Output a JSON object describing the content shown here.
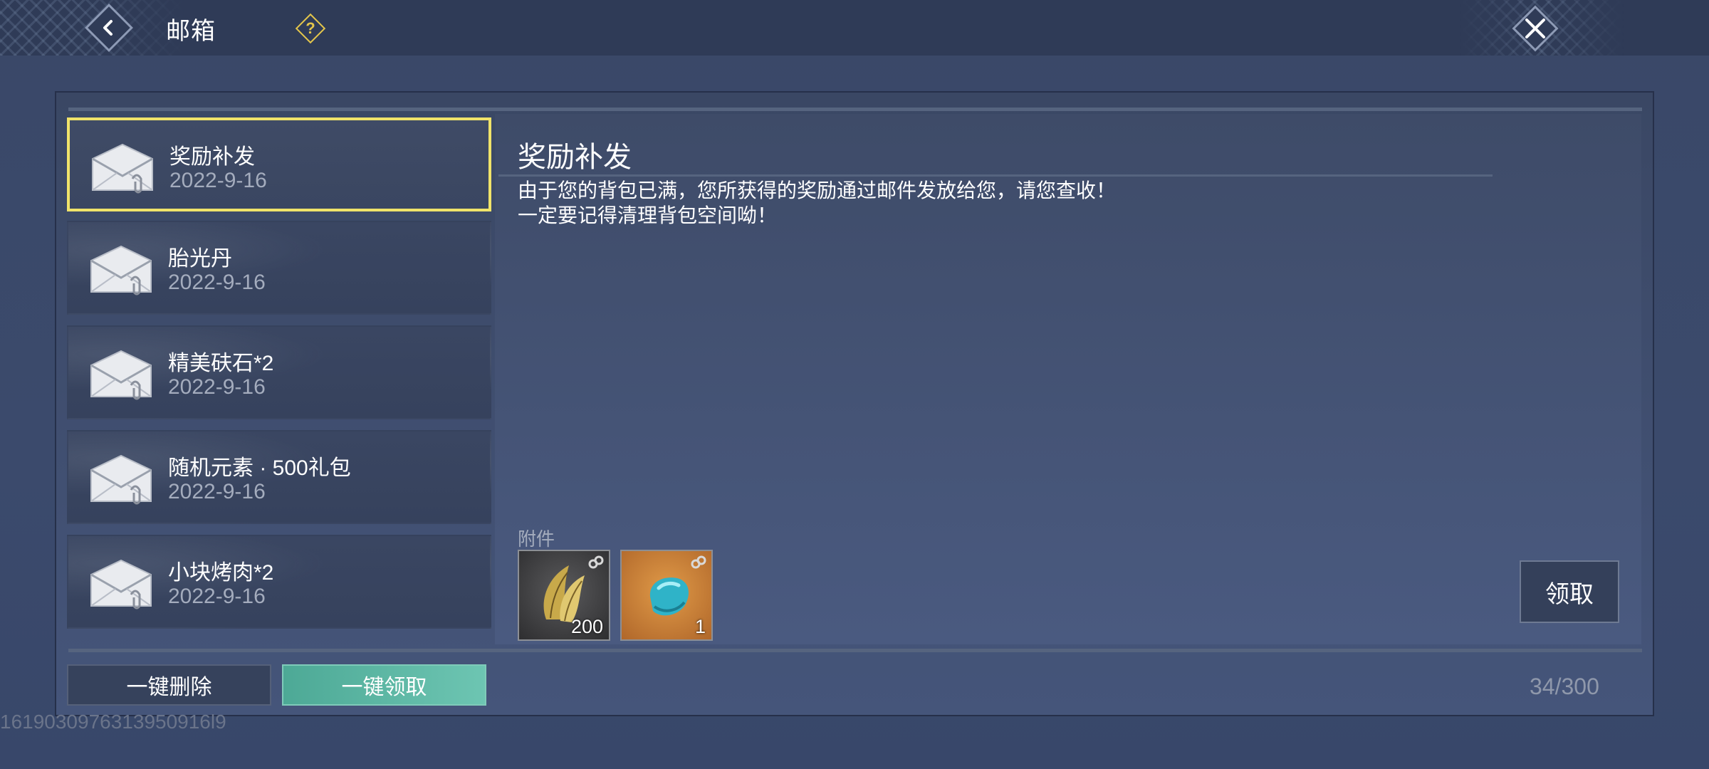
{
  "header": {
    "title": "邮箱",
    "back_icon": "chevron-left-icon",
    "help_icon": "question-icon",
    "close_icon": "close-icon"
  },
  "mail_list": [
    {
      "subject": "奖励补发",
      "date": "2022-9-16",
      "selected": true
    },
    {
      "subject": "胎光丹",
      "date": "2022-9-16",
      "selected": false
    },
    {
      "subject": "精美砆石*2",
      "date": "2022-9-16",
      "selected": false
    },
    {
      "subject": "随机元素 · 500礼包",
      "date": "2022-9-16",
      "selected": false
    },
    {
      "subject": "小块烤肉*2",
      "date": "2022-9-16",
      "selected": false
    }
  ],
  "detail": {
    "title": "奖励补发",
    "body_line1": "由于您的背包已满，您所获得的奖励通过邮件发放给您，请您查收！",
    "body_line2": "一定要记得清理背包空间呦！",
    "attachments_label": "附件",
    "attachments": [
      {
        "icon": "gold-leaf-icon",
        "count": "200",
        "background": "#3a3a3c"
      },
      {
        "icon": "blue-gem-icon",
        "count": "1",
        "background": "#c07a2e"
      }
    ],
    "claim_label": "领取"
  },
  "footer": {
    "delete_all_label": "一键删除",
    "claim_all_label": "一键领取",
    "mail_count": "34/300"
  },
  "watermark": "1619030976313950916l9",
  "colors": {
    "selected_border": "#f0e36a",
    "claim_all": "#5db7a3",
    "help_accent": "#e3c54b"
  }
}
